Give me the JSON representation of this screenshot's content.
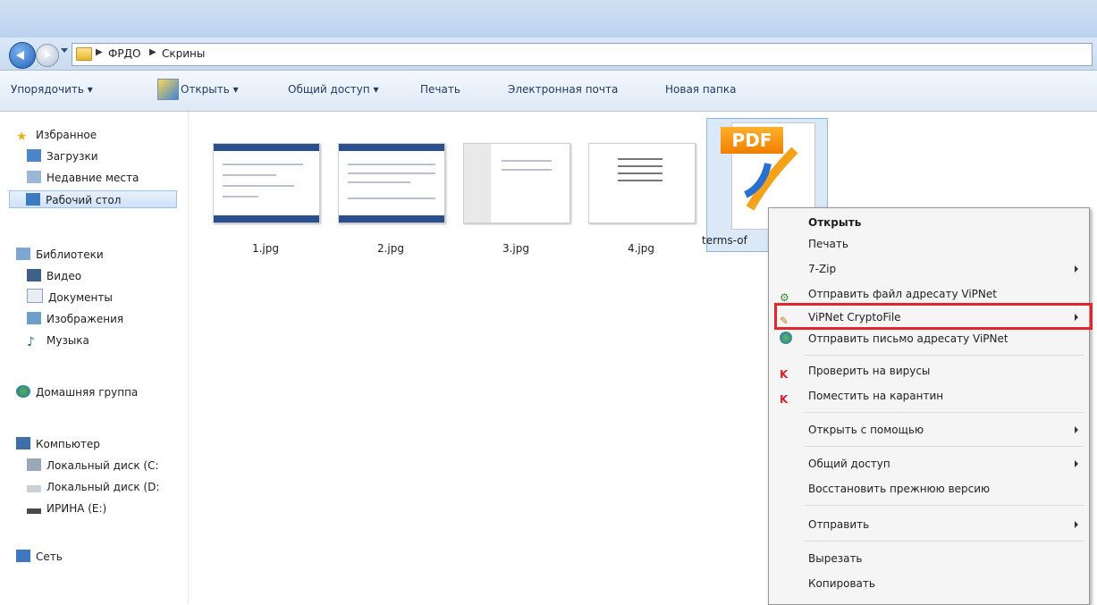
{
  "address": {
    "crumbs": [
      "ФРДО",
      "Скрины"
    ]
  },
  "toolbar": {
    "organize": "Упорядочить ▾",
    "open": "Открыть ▾",
    "share": "Общий доступ ▾",
    "print": "Печать",
    "email": "Электронная почта",
    "new_folder": "Новая папка"
  },
  "nav": {
    "favorites": "Избранное",
    "downloads": "Загрузки",
    "recent": "Недавние места",
    "desktop": "Рабочий стол",
    "libraries": "Библиотеки",
    "video": "Видео",
    "documents": "Документы",
    "images": "Изображения",
    "music": "Музыка",
    "homegroup": "Домашняя группа",
    "computer": "Компьютер",
    "disk_c": "Локальный диск (C:",
    "disk_d": "Локальный диск (D:",
    "disk_e": "ИРИНА (E:)",
    "network": "Сеть"
  },
  "files": [
    {
      "name": "1.jpg"
    },
    {
      "name": "2.jpg"
    },
    {
      "name": "3.jpg"
    },
    {
      "name": "4.jpg"
    },
    {
      "name": "terms-of",
      "badge": "PDF"
    }
  ],
  "context_menu": {
    "items": [
      {
        "label": "Открыть"
      },
      {
        "label": "Печать"
      },
      {
        "label": "7-Zip"
      },
      {
        "label": "Отправить файл адресату ViPNet"
      },
      {
        "label": "ViPNet CryptoFile"
      },
      {
        "label": "Отправить письмо адресату ViPNet"
      },
      {
        "label": "Проверить на вирусы"
      },
      {
        "label": "Поместить на карантин"
      },
      {
        "label": "Открыть с помощью"
      },
      {
        "label": "Общий доступ"
      },
      {
        "label": "Восстановить прежнюю версию"
      },
      {
        "label": "Отправить"
      },
      {
        "label": "Вырезать"
      },
      {
        "label": "Копировать"
      }
    ],
    "highlight_color": "#e3262e"
  }
}
